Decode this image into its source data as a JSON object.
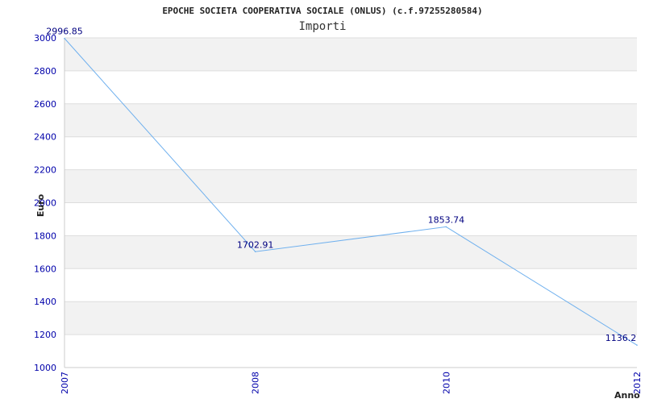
{
  "chart_data": {
    "type": "line",
    "title": "EPOCHE SOCIETA COOPERATIVA SOCIALE (ONLUS) (c.f.97255280584)",
    "subtitle": "Importi",
    "ylabel": "Euro",
    "xlabel": "Anno",
    "categories": [
      "2007",
      "2008",
      "2010",
      "2012"
    ],
    "values": [
      2996.85,
      1702.91,
      1853.74,
      1136.2
    ],
    "data_labels": [
      "2996.85",
      "1702.91",
      "1853.74",
      "1136.2"
    ],
    "y_ticks": [
      1000,
      1200,
      1400,
      1600,
      1800,
      2000,
      2200,
      2400,
      2600,
      2800,
      3000
    ],
    "ylim": [
      1000,
      3000
    ],
    "grid": true,
    "colors": {
      "line": "#6fb0ee",
      "band": "#f2f2f2",
      "grid": "#dddddd",
      "tick_text": "#0000aa",
      "data_label": "#000080"
    }
  }
}
